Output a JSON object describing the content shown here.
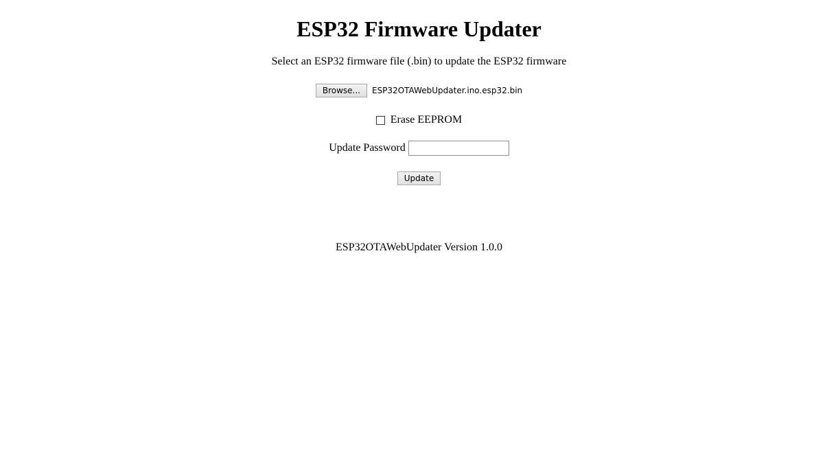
{
  "page": {
    "title": "ESP32 Firmware Updater",
    "instructions": "Select an ESP32 firmware file (.bin) to update the ESP32 firmware"
  },
  "file_picker": {
    "browse_label": "Browse...",
    "selected_file": "ESP32OTAWebUpdater.ino.esp32.bin"
  },
  "erase_eeprom": {
    "label": "Erase EEPROM",
    "checked": false
  },
  "password": {
    "label": "Update Password",
    "value": ""
  },
  "update_button": {
    "label": "Update"
  },
  "footer": {
    "version_text": "ESP32OTAWebUpdater Version 1.0.0"
  }
}
